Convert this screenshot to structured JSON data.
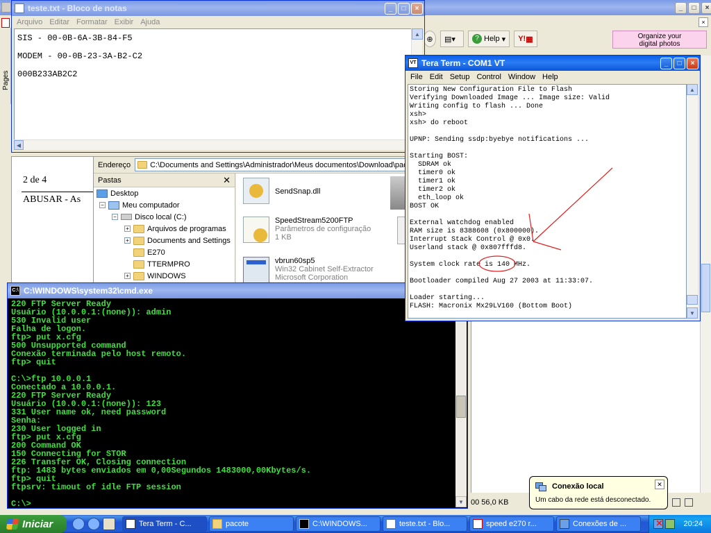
{
  "pdf": {
    "toolbar": {
      "help_label": "Help",
      "yahoo_label": "Y!"
    },
    "organize_ad": {
      "line1": "Organize your",
      "line2": "digital photos"
    },
    "pages_tab": "Pages",
    "page_indicator": "2 de 4",
    "doc_text": "ABUSAR - As",
    "status_text": "00  56,0 KB"
  },
  "notepad": {
    "title": "teste.txt - Bloco de notas",
    "menu": [
      "Arquivo",
      "Editar",
      "Formatar",
      "Exibir",
      "Ajuda"
    ],
    "lines": [
      "SIS - 00-0B-6A-3B-84-F5",
      "MODEM - 00-0B-23-3A-B2-C2",
      "000B233AB2C2"
    ]
  },
  "explorer": {
    "address_label": "Endereço",
    "address_value": "C:\\Documents and Settings\\Administrador\\Meus documentos\\Download\\pacote",
    "folders_label": "Pastas",
    "tree": [
      {
        "label": "Desktop"
      },
      {
        "label": "Meu computador"
      },
      {
        "label": "Disco local (C:)"
      },
      {
        "label": "Arquivos de programas"
      },
      {
        "label": "Documents and Settings"
      },
      {
        "label": "E270"
      },
      {
        "label": "TTERMPRO"
      },
      {
        "label": "WINDOWS"
      }
    ],
    "files": [
      {
        "name": "SendSnap.dll",
        "desc": "",
        "size": ""
      },
      {
        "name": "SpeedStream5200FTP",
        "desc": "Parâmetros de configuração",
        "size": "1 KB"
      },
      {
        "name": "vbrun60sp5",
        "desc": "Win32 Cabinet Self-Extractor",
        "size": "Microsoft Corporation"
      }
    ]
  },
  "cmd": {
    "title": "C:\\WINDOWS\\system32\\cmd.exe",
    "lines": [
      "220 FTP Server Ready",
      "Usuário (10.0.0.1:(none)): admin",
      "530 Invalid user",
      "Falha de logon.",
      "ftp> put x.cfg",
      "500 Unsupported command",
      "Conexão terminada pelo host remoto.",
      "ftp> quit",
      "",
      "C:\\>ftp 10.0.0.1",
      "Conectado a 10.0.0.1.",
      "220 FTP Server Ready",
      "Usuário (10.0.0.1:(none)): 123",
      "331 User name ok, need password",
      "Senha:",
      "230 User logged in",
      "ftp> put x.cfg",
      "200 Command OK",
      "150 Connecting for STOR",
      "226 Transfer OK, Closing connection",
      "ftp: 1483 bytes enviados em 0,00Segundos 1483000,00Kbytes/s.",
      "ftp> quit",
      "ftpsrv: timout of idle FTP session",
      "",
      "C:\\>"
    ]
  },
  "tera": {
    "title": "Tera Term - COM1 VT",
    "menu": [
      "File",
      "Edit",
      "Setup",
      "Control",
      "Window",
      "Help"
    ],
    "lines": [
      "Storing New Configuration File to Flash",
      "Verifying Downloaded Image ... Image size: Valid",
      "Writing config to flash ... Done",
      "xsh>",
      "xsh> do reboot",
      "",
      "UPNP: Sending ssdp:byebye notifications ...",
      "",
      "Starting BOST:",
      "  SDRAM ok",
      "  timer0 ok",
      "  timer1 ok",
      "  timer2 ok",
      "  eth_loop ok",
      "BOST OK",
      "",
      "External watchdog enabled",
      "RAM size is 8388608 (0x800000).",
      "Interrupt Stack Control @ 0x0.",
      "Userland stack @ 0x807fffd8.",
      "",
      "System clock rate is 140 MHz.",
      "",
      "Bootloader compiled Aug 27 2003 at 11:33:07.",
      "",
      "Loader starting...",
      "FLASH: Macronix Mx29LV160 (Bottom Boot)"
    ]
  },
  "balloon": {
    "title": "Conexão local",
    "text": "Um cabo da rede está desconectado."
  },
  "taskbar": {
    "start": "Iniciar",
    "tasks": [
      "Tera Term - C...",
      "pacote",
      "C:\\WINDOWS...",
      "teste.txt - Blo...",
      "speed e270 r...",
      "Conexões de ..."
    ],
    "clock": "20:24"
  },
  "colors": {
    "cmd_text": "#3ee03e",
    "annotation_red": "#e02020",
    "title_active": "#0a5fe8"
  }
}
